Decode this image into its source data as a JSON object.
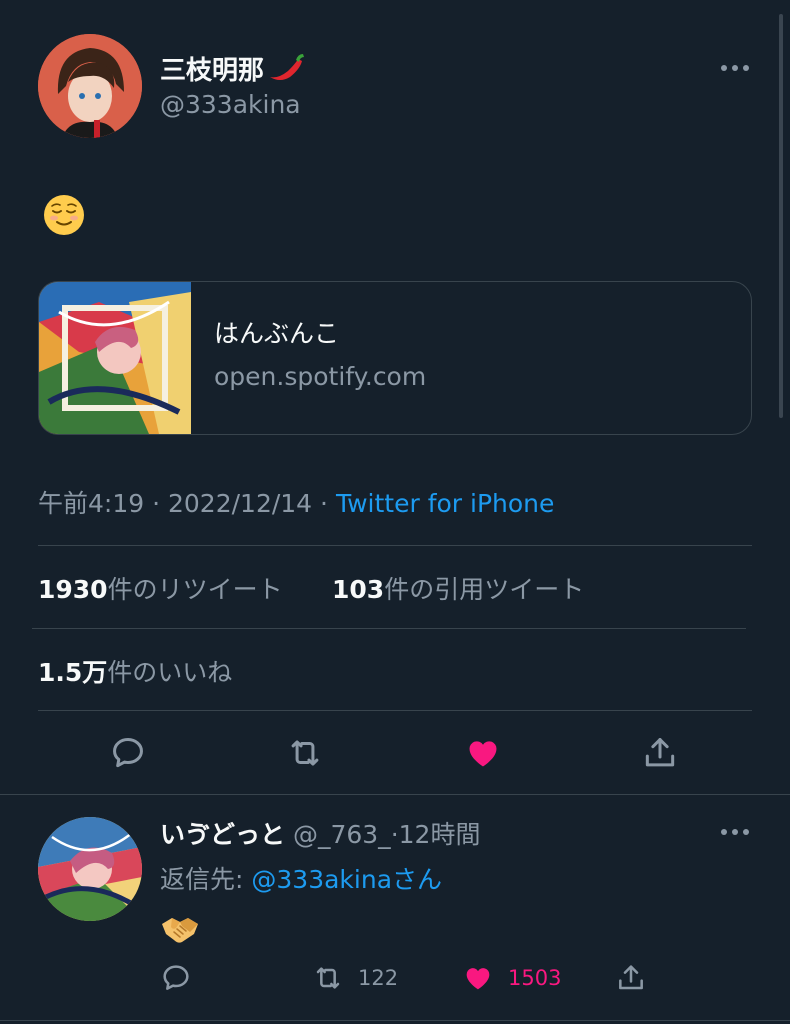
{
  "tweet": {
    "author_name": "三枝明那",
    "author_handle": "@333akina",
    "body_emoji": "😌",
    "card": {
      "title": "はんぶんこ",
      "domain": "open.spotify.com"
    },
    "time": "午前4:19",
    "date": "2022/12/14",
    "source": "Twitter for iPhone",
    "sep": "·",
    "retweets_count": "1930",
    "retweets_label": "件のリツイート",
    "quotes_count": "103",
    "quotes_label": "件の引用ツイート",
    "likes_count": "1.5万",
    "likes_label": "件のいいね",
    "liked": true
  },
  "reply": {
    "author_name": "いゔどっと",
    "author_handle": "@_763_",
    "sep": "·",
    "age": "12時間",
    "reply_to_prefix": "返信先:",
    "reply_to_handle": "@333akina",
    "reply_to_suffix": "さん",
    "body_emoji": "🫱🏻‍🫲🏼",
    "retweets": "122",
    "likes": "1503",
    "liked": true
  },
  "colors": {
    "background": "#15202b",
    "text": "#f7f9f9",
    "muted": "#8b98a5",
    "link": "#1d9bf0",
    "like": "#f91880",
    "border": "#38444d"
  },
  "icons": [
    "chili-pepper-icon",
    "more-icon",
    "reply-icon",
    "retweet-icon",
    "heart-icon",
    "share-icon",
    "handshake-icon",
    "relieved-face-icon"
  ]
}
